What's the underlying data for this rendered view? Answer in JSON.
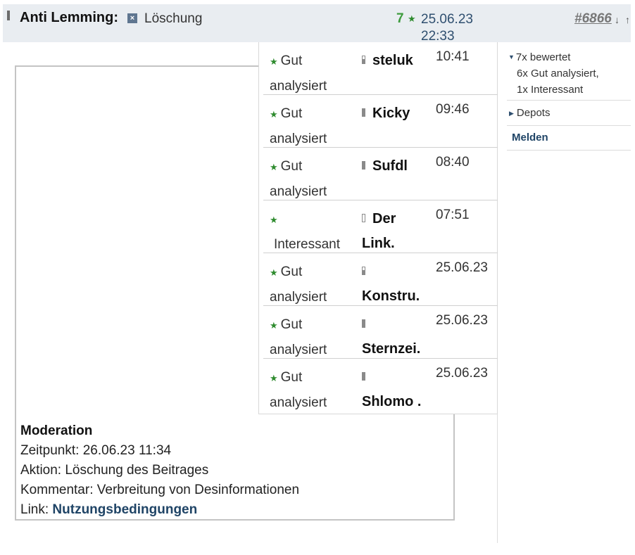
{
  "header": {
    "user_name": "Anti Lemming:",
    "deleted_icon": "x-box-icon",
    "status": "Löschung",
    "rating_count": "7",
    "rating_star": "★",
    "date": "25.06.23",
    "time": "22:33",
    "post_number": "#6866",
    "arrow_down": "↓",
    "arrow_up": "↑"
  },
  "ratings_popup": {
    "rows": [
      {
        "type": "Gut analysiert",
        "user": "steluk",
        "time": "10:41"
      },
      {
        "type": "Gut analysiert",
        "user": "Kicky",
        "time": "09:46"
      },
      {
        "type": "Gut analysiert",
        "user": "Sufdl",
        "time": "08:40"
      },
      {
        "type": "Interessant",
        "user": "Der Link.",
        "time": "07:51"
      },
      {
        "type": "Gut analysiert",
        "user": "Konstru.",
        "time": "25.06.23"
      },
      {
        "type": "Gut analysiert",
        "user": "Sternzei.",
        "time": "25.06.23"
      },
      {
        "type": "Gut analysiert",
        "user": "Shlomo .",
        "time": "25.06.23"
      }
    ]
  },
  "moderation": {
    "title": "Moderation",
    "time_label": "Zeitpunkt: 26.06.23 11:34",
    "action_label": "Aktion: Löschung des Beitrages",
    "comment_label": "Kommentar: Verbreitung von Desinformationen",
    "link_prefix": "Link: ",
    "link_text": "Nutzungsbedingungen"
  },
  "sidebar": {
    "ratings_summary": "7x bewertet",
    "ratings_detail_1": "6x Gut analysiert,",
    "ratings_detail_2": "1x Interessant",
    "depots": "Depots",
    "report": "Melden"
  },
  "colors": {
    "header_bg": "#e9edf1",
    "accent_green": "#3d9b3d",
    "link_blue": "#1f4466"
  }
}
